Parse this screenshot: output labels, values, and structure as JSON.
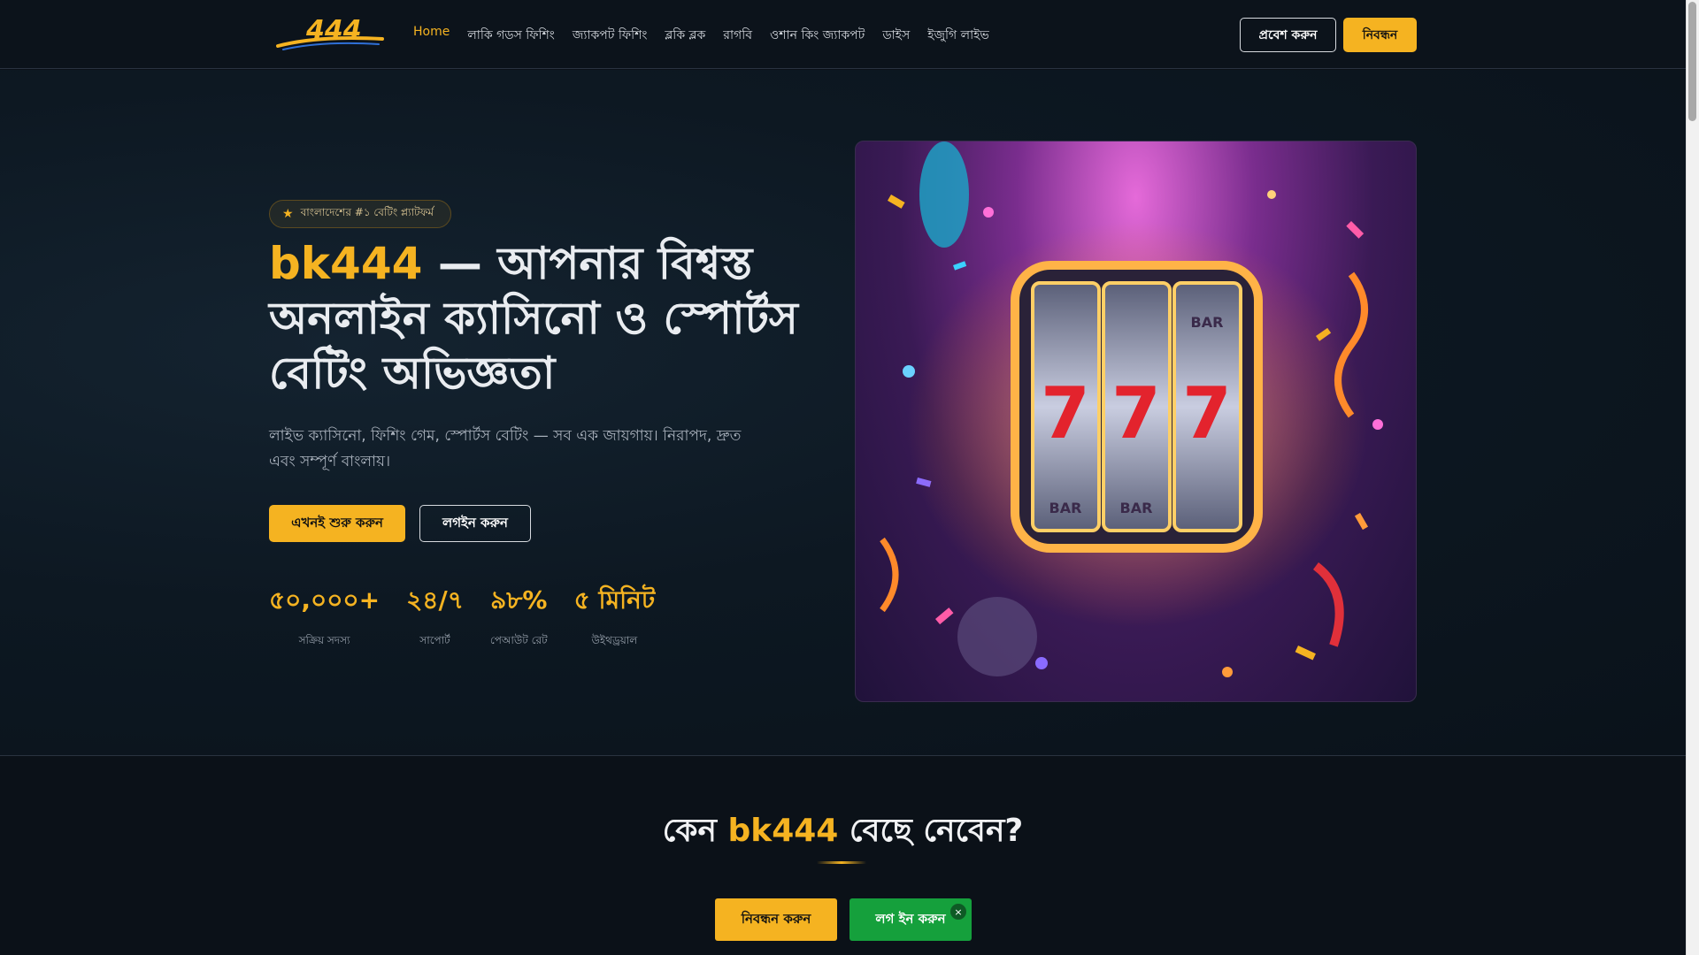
{
  "header": {
    "logo_text": "444",
    "nav": [
      "Home",
      "লাকি গডস ফিশিং",
      "জ্যাকপট ফিশিং",
      "ব্লকি ব্লক",
      "রাগবি",
      "ওশান কিং জ্যাকপট",
      "ডাইস",
      "ইজুগি লাইভ"
    ],
    "login_label": "প্রবেশ করুন",
    "register_label": "নিবন্ধন"
  },
  "hero": {
    "badge": "বাংলাদেশের #১ বেটিং প্ল্যাটফর্ম",
    "title_brand": "bk444",
    "title_rest": " — আপনার বিশ্বস্ত অনলাইন ক্যাসিনো ও স্পোর্টস বেটিং অভিজ্ঞতা",
    "subtitle": "লাইভ ক্যাসিনো, ফিশিং গেম, স্পোর্টস বেটিং — সব এক জায়গায়। নিরাপদ, দ্রুত এবং সম্পূর্ণ বাংলায়।",
    "cta_start": "এখনই শুরু করুন",
    "cta_login": "লগইন করুন",
    "stats": [
      {
        "value": "৫০,০০০+",
        "label": "সক্রিয় সদস্য"
      },
      {
        "value": "২৪/৭",
        "label": "সাপোর্ট"
      },
      {
        "value": "৯৮%",
        "label": "পেআউট রেট"
      },
      {
        "value": "৫ মিনিট",
        "label": "উইথড্রয়াল"
      }
    ],
    "slot_symbols": [
      "7",
      "7",
      "7",
      "BAR",
      "BAR",
      "BAR"
    ]
  },
  "why": {
    "prefix": "কেন ",
    "brand": "bk444",
    "suffix": " বেছে নেবেন?"
  },
  "sticky": {
    "register": "নিবন্ধন করুন",
    "login": "লগ ইন করুন",
    "close": "×"
  },
  "colors": {
    "accent": "#f5b321",
    "background": "#0b1118",
    "green": "#15a03c"
  }
}
